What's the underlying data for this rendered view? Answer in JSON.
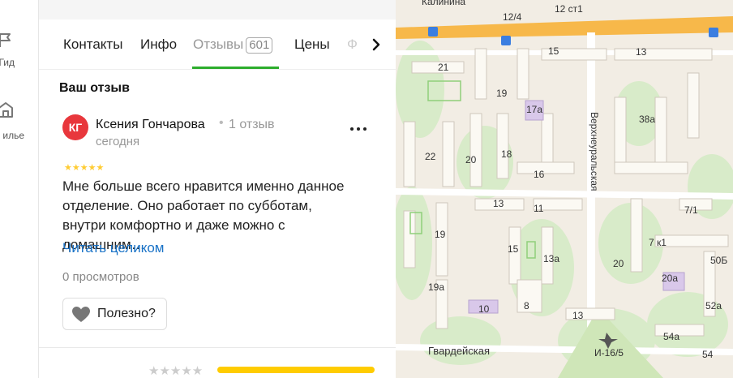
{
  "rail": {
    "items": [
      {
        "label": "Гид",
        "icon": "flag-icon"
      },
      {
        "label": "илье",
        "icon": "house-icon"
      }
    ]
  },
  "tabs": {
    "items": [
      {
        "label": "Контакты"
      },
      {
        "label": "Инфо"
      },
      {
        "label": "Отзывы",
        "count": "601"
      },
      {
        "label": "Цены"
      }
    ],
    "truncated": "Ф",
    "active_index": 2
  },
  "review": {
    "section_title": "Ваш отзыв",
    "avatar_initials": "КГ",
    "author": "Ксения Гончарова",
    "author_separator": "•",
    "author_reviews": "1 отзыв",
    "date": "сегодня",
    "rating": 5,
    "text": "Мне больше всего нравится именно данное отделение. Оно работает по субботам, внутри комфортно и даже можно с домашним…",
    "read_more": "Читать целиком",
    "views": "0 просмотров",
    "useful": "Полезно?"
  },
  "map": {
    "streets": [
      "Калинина",
      "Верхнеуральская",
      "Гвардейская"
    ],
    "labels": [
      "12/4",
      "12 ст1",
      "15",
      "13",
      "21",
      "19",
      "17а",
      "38а",
      "22",
      "20",
      "18",
      "16",
      "13",
      "11",
      "7/1",
      "19",
      "15",
      "13а",
      "7 к1",
      "50Б",
      "20",
      "20а",
      "19а",
      "10",
      "8",
      "52а",
      "13",
      "54а",
      "И-16/5",
      "54"
    ]
  },
  "colors": {
    "accent_green": "#2dad2d",
    "link_blue": "#1a73c7",
    "avatar_red": "#e8373c",
    "star_yellow": "#ffcc00"
  }
}
